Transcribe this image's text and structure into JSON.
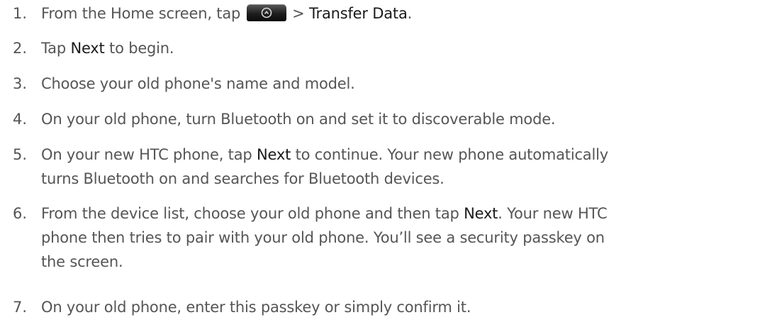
{
  "steps": [
    {
      "num": "1.",
      "a": "From the Home screen, tap ",
      "icon": "home-menu-button-icon",
      "b": " > ",
      "bold1": "Transfer Data",
      "c": "."
    },
    {
      "num": "2.",
      "a": "Tap ",
      "bold1": "Next",
      "b": " to begin."
    },
    {
      "num": "3.",
      "a": "Choose your old phone's name and model."
    },
    {
      "num": "4.",
      "a": "On your old phone, turn Bluetooth on and set it to discoverable mode."
    },
    {
      "num": "5.",
      "a": "On your new HTC phone, tap ",
      "bold1": "Next",
      "b": " to continue. Your new phone automatically",
      "line2": "turns Bluetooth on and searches for Bluetooth devices."
    },
    {
      "num": "6.",
      "a": "From the device list, choose your old phone and then tap ",
      "bold1": "Next",
      "b": ". Your new HTC",
      "line2": "phone then tries to pair with your old phone. You’ll see a security passkey on",
      "line3": "the screen."
    },
    {
      "num": "7.",
      "a": "On your old phone, enter this passkey or simply confirm it."
    }
  ]
}
